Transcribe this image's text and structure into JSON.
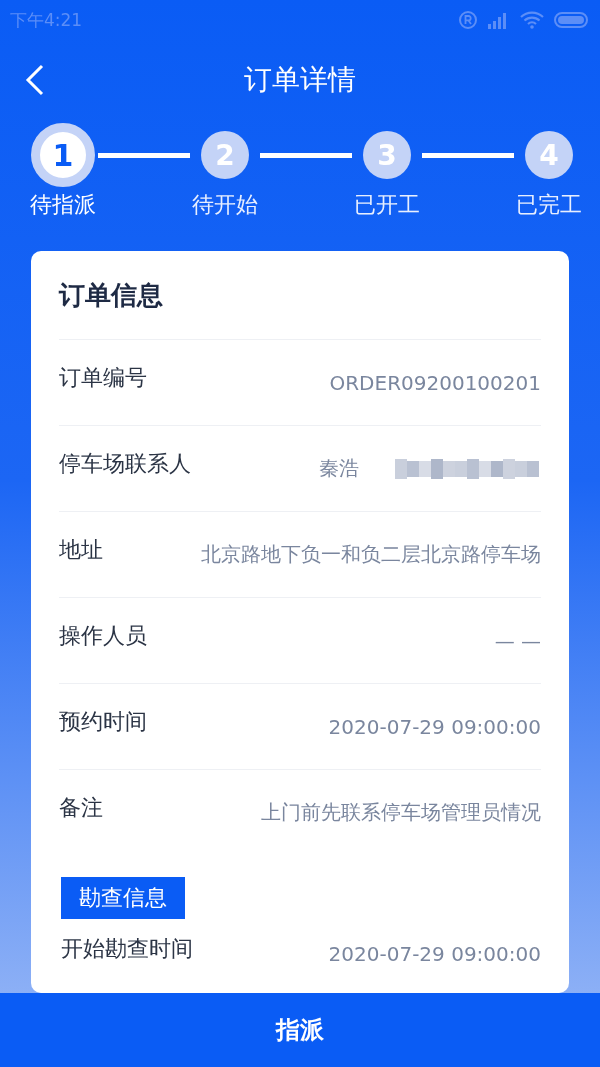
{
  "status_bar": {
    "time": "下午4:21"
  },
  "header": {
    "title": "订单详情"
  },
  "steps": [
    {
      "number": "1",
      "label": "待指派",
      "selected": true
    },
    {
      "number": "2",
      "label": "待开始",
      "selected": false
    },
    {
      "number": "3",
      "label": "已开工",
      "selected": false
    },
    {
      "number": "4",
      "label": "已完工",
      "selected": false
    }
  ],
  "order_info": {
    "title": "订单信息",
    "rows": [
      {
        "label": "订单编号",
        "value": "ORDER09200100201",
        "redacted": false
      },
      {
        "label": "停车场联系人",
        "value": "秦浩",
        "redacted": true
      },
      {
        "label": "地址",
        "value": "北京路地下负一和负二层北京路停车场",
        "redacted": false
      },
      {
        "label": "操作人员",
        "value": "— —",
        "redacted": false
      },
      {
        "label": "预约时间",
        "value": "2020-07-29 09:00:00",
        "redacted": false
      },
      {
        "label": "备注",
        "value": "上门前先联系停车场管理员情况",
        "redacted": false
      }
    ]
  },
  "survey_info": {
    "tag": "勘查信息",
    "rows": [
      {
        "label": "开始勘查时间",
        "value": "2020-07-29 09:00:00",
        "redacted": false
      }
    ]
  },
  "action_button": "指派"
}
